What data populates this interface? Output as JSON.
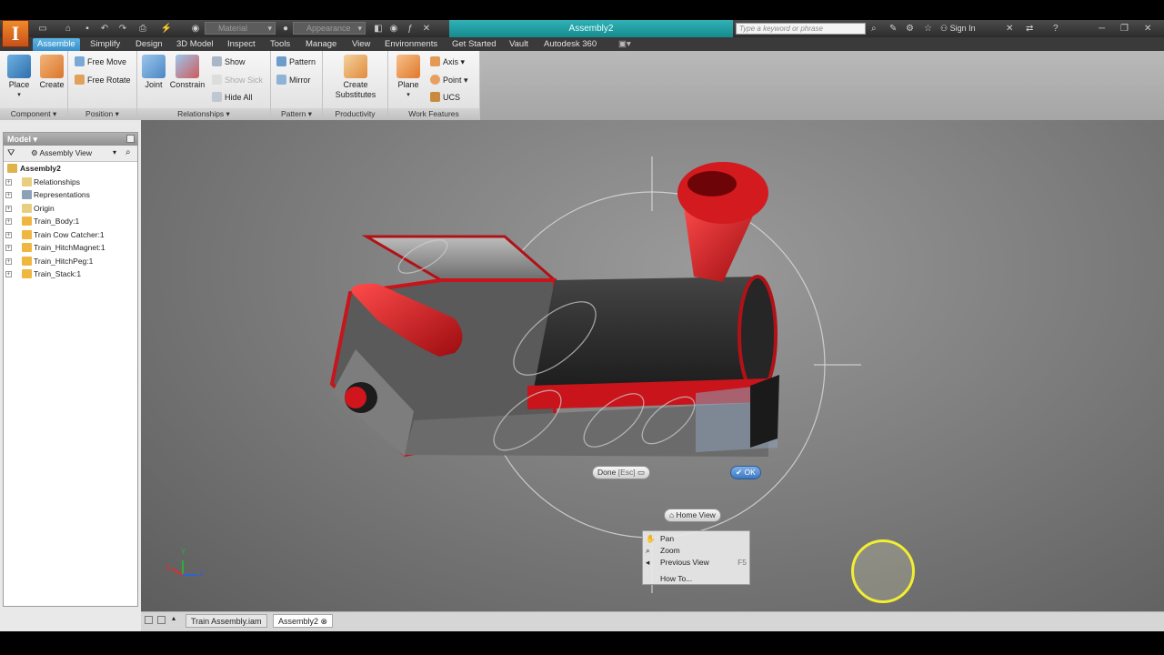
{
  "app": {
    "logo_letter": "I",
    "document_title": "Assembly2"
  },
  "quick_access": {
    "material_placeholder": "Material",
    "appearance_placeholder": "Appearance"
  },
  "search": {
    "placeholder": "Type a keyword or phrase"
  },
  "account": {
    "sign_in": "Sign In"
  },
  "ribbon_tabs": [
    "Assemble",
    "Simplify",
    "Design",
    "3D Model",
    "Inspect",
    "Tools",
    "Manage",
    "View",
    "Environments",
    "Get Started",
    "Vault",
    "Autodesk 360"
  ],
  "ribbon": {
    "component": {
      "label": "Component",
      "place": "Place",
      "create": "Create"
    },
    "position": {
      "label": "Position",
      "free_move": "Free Move",
      "free_rotate": "Free Rotate"
    },
    "relationships": {
      "label": "Relationships",
      "joint": "Joint",
      "constrain": "Constrain",
      "show": "Show",
      "show_sick": "Show Sick",
      "hide_all": "Hide All"
    },
    "pattern": {
      "label": "Pattern",
      "pattern": "Pattern",
      "mirror": "Mirror"
    },
    "productivity": {
      "label": "Productivity",
      "create_substitutes": "Create Substitutes"
    },
    "work_features": {
      "label": "Work Features",
      "plane": "Plane",
      "axis": "Axis",
      "point": "Point",
      "ucs": "UCS"
    }
  },
  "model_browser": {
    "title": "Model",
    "view_select": "Assembly View",
    "root": "Assembly2",
    "items": [
      "Relationships",
      "Representations",
      "Origin",
      "Train_Body:1",
      "Train Cow Catcher:1",
      "Train_HitchMagnet:1",
      "Train_HitchPeg:1",
      "Train_Stack:1"
    ]
  },
  "viewport": {
    "done_pill": "Done",
    "done_key": "[Esc]",
    "ok_pill": "OK",
    "home_view": "Home View",
    "context_menu": [
      {
        "label": "Pan",
        "shortcut": ""
      },
      {
        "label": "Zoom",
        "shortcut": ""
      },
      {
        "label": "Previous View",
        "shortcut": "F5"
      },
      {
        "label": "How To...",
        "shortcut": ""
      }
    ],
    "axes": {
      "x": "X",
      "y": "Y",
      "z": "Z"
    }
  },
  "document_tabs": [
    "Train Assembly.iam",
    "Assembly2"
  ],
  "colors": {
    "accent": "#3a8fc8",
    "doc_tab": "#1f9ea3",
    "train_red": "#c8141a",
    "highlight_ring": "#f2ee32"
  }
}
